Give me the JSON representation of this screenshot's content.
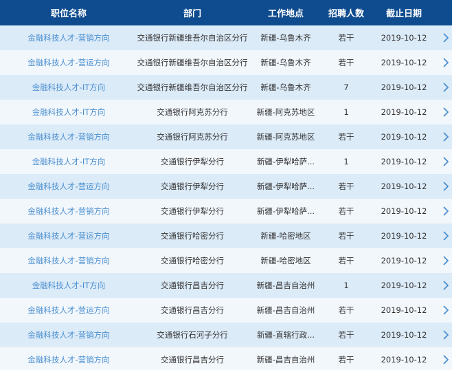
{
  "header": {
    "col_title": "职位名称",
    "col_dept": "部门",
    "col_location": "工作地点",
    "col_count": "招聘人数",
    "col_deadline": "截止日期"
  },
  "colors": {
    "header_bg": "#0f4c8f",
    "row_alt": "#dcebf8",
    "row_plain": "#f2f7fc",
    "link": "#4a8fcf"
  },
  "rows": [
    {
      "title": "金融科技人才-营销方向",
      "dept": "交通银行新疆维吾尔自治区分行",
      "location": "新疆-乌鲁木齐",
      "count": "若干",
      "deadline": "2019-10-12"
    },
    {
      "title": "金融科技人才-营运方向",
      "dept": "交通银行新疆维吾尔自治区分行",
      "location": "新疆-乌鲁木齐",
      "count": "若干",
      "deadline": "2019-10-12"
    },
    {
      "title": "金融科技人才-IT方向",
      "dept": "交通银行新疆维吾尔自治区分行",
      "location": "新疆-乌鲁木齐",
      "count": "7",
      "deadline": "2019-10-12"
    },
    {
      "title": "金融科技人才-IT方向",
      "dept": "交通银行阿克苏分行",
      "location": "新疆-阿克苏地区",
      "count": "1",
      "deadline": "2019-10-12"
    },
    {
      "title": "金融科技人才-营销方向",
      "dept": "交通银行阿克苏分行",
      "location": "新疆-阿克苏地区",
      "count": "若干",
      "deadline": "2019-10-12"
    },
    {
      "title": "金融科技人才-IT方向",
      "dept": "交通银行伊犁分行",
      "location": "新疆-伊犁哈萨...",
      "count": "1",
      "deadline": "2019-10-12"
    },
    {
      "title": "金融科技人才-营运方向",
      "dept": "交通银行伊犁分行",
      "location": "新疆-伊犁哈萨...",
      "count": "若干",
      "deadline": "2019-10-12"
    },
    {
      "title": "金融科技人才-营销方向",
      "dept": "交通银行伊犁分行",
      "location": "新疆-伊犁哈萨...",
      "count": "若干",
      "deadline": "2019-10-12"
    },
    {
      "title": "金融科技人才-营运方向",
      "dept": "交通银行哈密分行",
      "location": "新疆-哈密地区",
      "count": "若干",
      "deadline": "2019-10-12"
    },
    {
      "title": "金融科技人才-营销方向",
      "dept": "交通银行哈密分行",
      "location": "新疆-哈密地区",
      "count": "若干",
      "deadline": "2019-10-12"
    },
    {
      "title": "金融科技人才-IT方向",
      "dept": "交通银行昌吉分行",
      "location": "新疆-昌吉自治州",
      "count": "1",
      "deadline": "2019-10-12"
    },
    {
      "title": "金融科技人才-营运方向",
      "dept": "交通银行昌吉分行",
      "location": "新疆-昌吉自治州",
      "count": "若干",
      "deadline": "2019-10-12"
    },
    {
      "title": "金融科技人才-营销方向",
      "dept": "交通银行石河子分行",
      "location": "新疆-直辖行政...",
      "count": "若干",
      "deadline": "2019-10-12"
    },
    {
      "title": "金融科技人才-营销方向",
      "dept": "交通银行昌吉分行",
      "location": "新疆-昌吉自治州",
      "count": "若干",
      "deadline": "2019-10-12"
    }
  ],
  "row_icon": "chevron-right-icon"
}
